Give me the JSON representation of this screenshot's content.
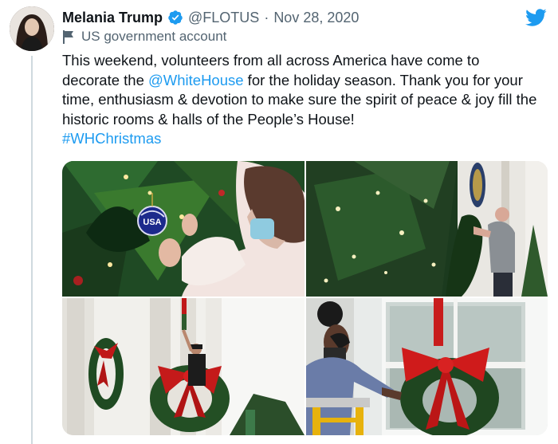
{
  "tweet": {
    "author_name": "Melania Trump",
    "handle": "@FLOTUS",
    "separator": "·",
    "date": "Nov 28, 2020",
    "account_label": "US government account",
    "text_part1": "This weekend, volunteers from all across America have come to decorate the ",
    "mention": "@WhiteHouse",
    "text_part2": " for the holiday season. Thank you for your time, enthusiasm & devotion to make sure the spirit of peace & joy fill the historic rooms & halls of the People’s House!",
    "hashtag": "#WHChristmas",
    "ornament_text": "USA"
  },
  "icons": {
    "verified": "verified-badge-icon",
    "flag": "flag-icon",
    "brand": "twitter-bird-icon"
  },
  "colors": {
    "link": "#1d9bf0",
    "secondary_text": "#536471",
    "brand": "#1d9bf0"
  }
}
